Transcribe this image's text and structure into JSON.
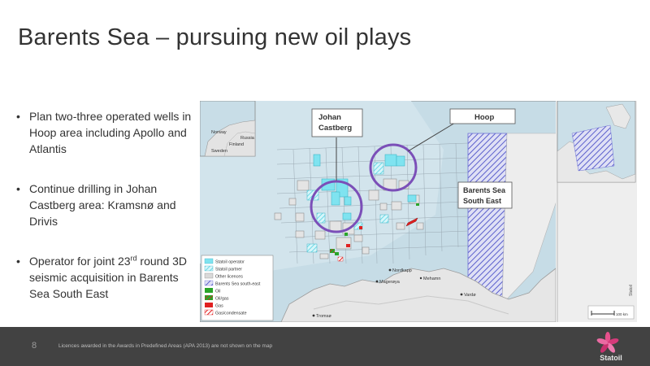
{
  "slide": {
    "title": "Barents Sea – pursuing new oil plays",
    "bullets": [
      {
        "text": "Plan two-three operated wells in Hoop area including Apollo and Atlantis"
      },
      {
        "text": "Continue drilling in Johan Castberg area: Kramsnø and Drivis"
      },
      {
        "text_before": "Operator for joint 23",
        "sup": "rd",
        "text_after": " round 3D seismic acquisition in Barents Sea South East"
      }
    ]
  },
  "map": {
    "callouts": {
      "johan_line1": "Johan",
      "johan_line2": "Castberg",
      "hoop": "Hoop",
      "bsse_line1": "Barents Sea",
      "bsse_line2": "South East"
    },
    "inset_labels": {
      "norway": "Norway",
      "russia": "Russia",
      "finland": "Finland",
      "sweden": "Sweden"
    },
    "place_labels": {
      "nordkapp": "Nordkapp",
      "magerøya": "Magerøya",
      "vardø": "Vardø",
      "tromsø": "Tromsø",
      "mehamn": "Mehamn"
    },
    "legend": [
      {
        "label": "Statoil operator",
        "color": "#7fe3f0",
        "pattern": "solid"
      },
      {
        "label": "Statoil partner",
        "color": "#9fe9f3",
        "pattern": "hatch"
      },
      {
        "label": "Other licences",
        "color": "#d9d9d9",
        "pattern": "solid"
      },
      {
        "label": "Barents Sea south-east",
        "color": "#6b6fd4",
        "pattern": "hatch"
      },
      {
        "label": "Oil",
        "color": "#2aa52a",
        "pattern": "solid"
      },
      {
        "label": "Oil/gas",
        "color": "#2aa52a",
        "pattern": "hatch-red"
      },
      {
        "label": "Gas",
        "color": "#e02020",
        "pattern": "solid"
      },
      {
        "label": "Gas/condensate",
        "color": "#e02020",
        "pattern": "hatch"
      }
    ],
    "scale_label": "100 km",
    "copyright": "Statoil",
    "colors": {
      "sea": "#c4dbe6",
      "land": "#e8e8e8",
      "highlight_circle": "#7b4fb8",
      "statoil_cyan": "#7fe3f0"
    }
  },
  "footer": {
    "page_number": "8",
    "footnote": "Licences awarded in the Awards in Predefined Areas (APA 2013) are not shown on the map",
    "logo_text": "Statoil"
  }
}
